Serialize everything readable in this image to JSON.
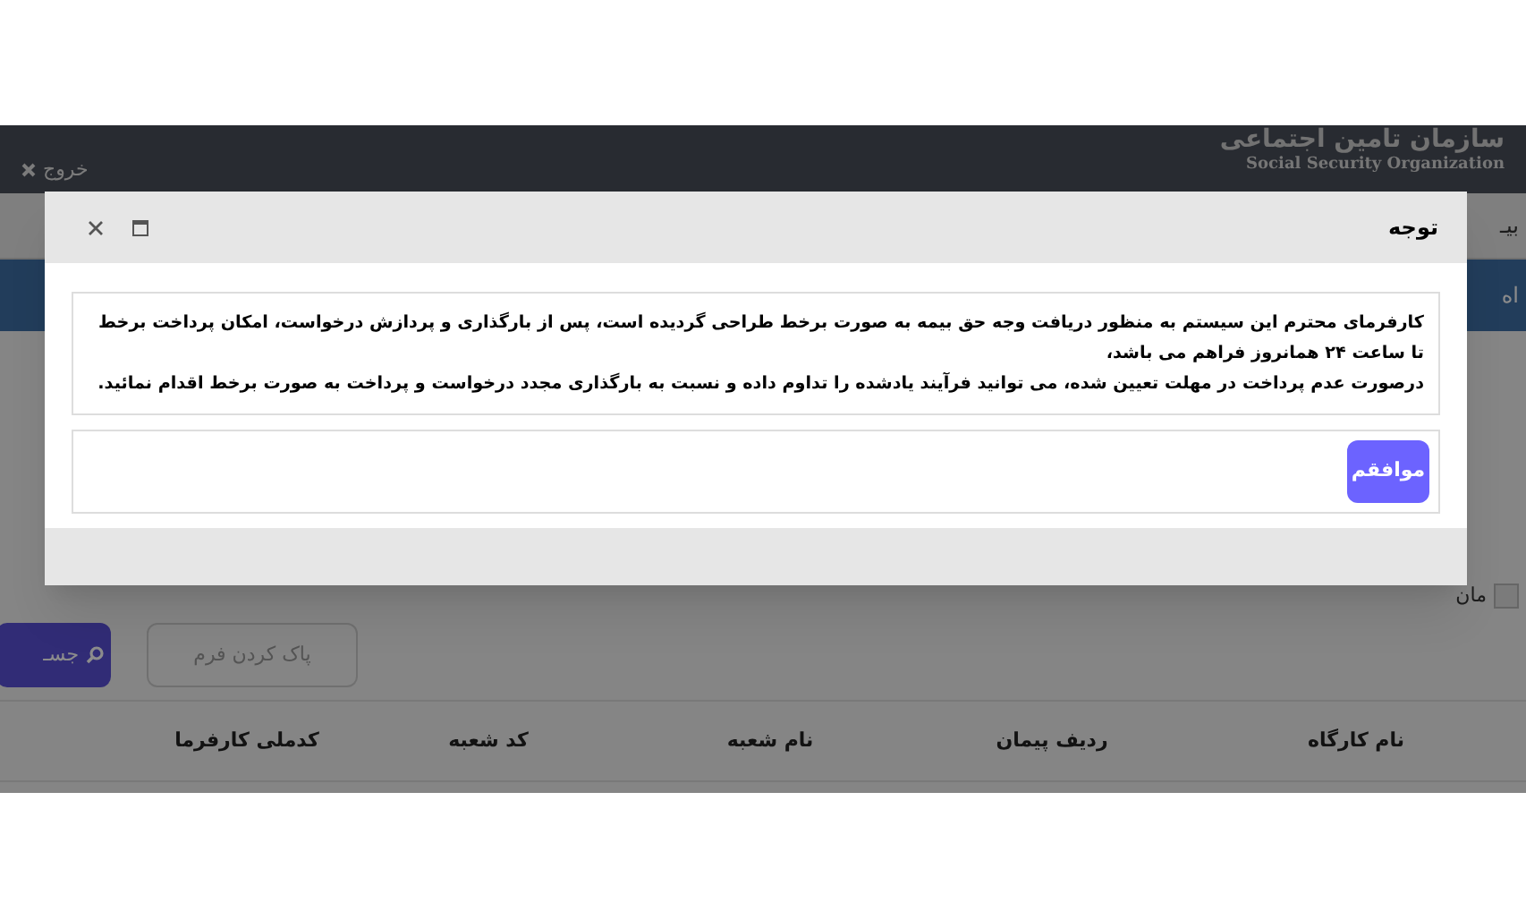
{
  "background_page": {
    "header": {
      "logout": "خروج",
      "logo_title": "سازمان تامین اجتماعی",
      "logo_subtitle": "Social Security Organization"
    },
    "nav_partial": "بیـ",
    "banner_partial": "اه",
    "checkbox": {
      "label": "مان",
      "checked": false
    },
    "buttons": [
      {
        "kind": "secondary",
        "label": "پاک کردن فرم"
      },
      {
        "kind": "primary",
        "label": "جسـ"
      }
    ],
    "table": {
      "columns": [
        "نام کارگاه",
        "ردیف پیمان",
        "نام شعبه",
        "کد شعبه",
        "کدملی کارفرما"
      ]
    }
  },
  "dialog": {
    "title": "توجه",
    "message": [
      "کارفرمای محترم این سیستم به منظور دریافت وجه حق بیمه به صورت برخط طراحی گردیده است، پس از بارگذاری و پردازش درخواست، امکان پرداخت برخط تا ساعت ۲۴ همانروز فراهم می باشد،",
      "درصورت عدم پرداخت در مهلت تعیین شده، می توانید فرآیند یادشده را تداوم داده و نسبت به بارگذاری مجدد درخواست و پرداخت به صورت برخط اقدام نمائید."
    ],
    "confirm_button": "موافقم"
  }
}
